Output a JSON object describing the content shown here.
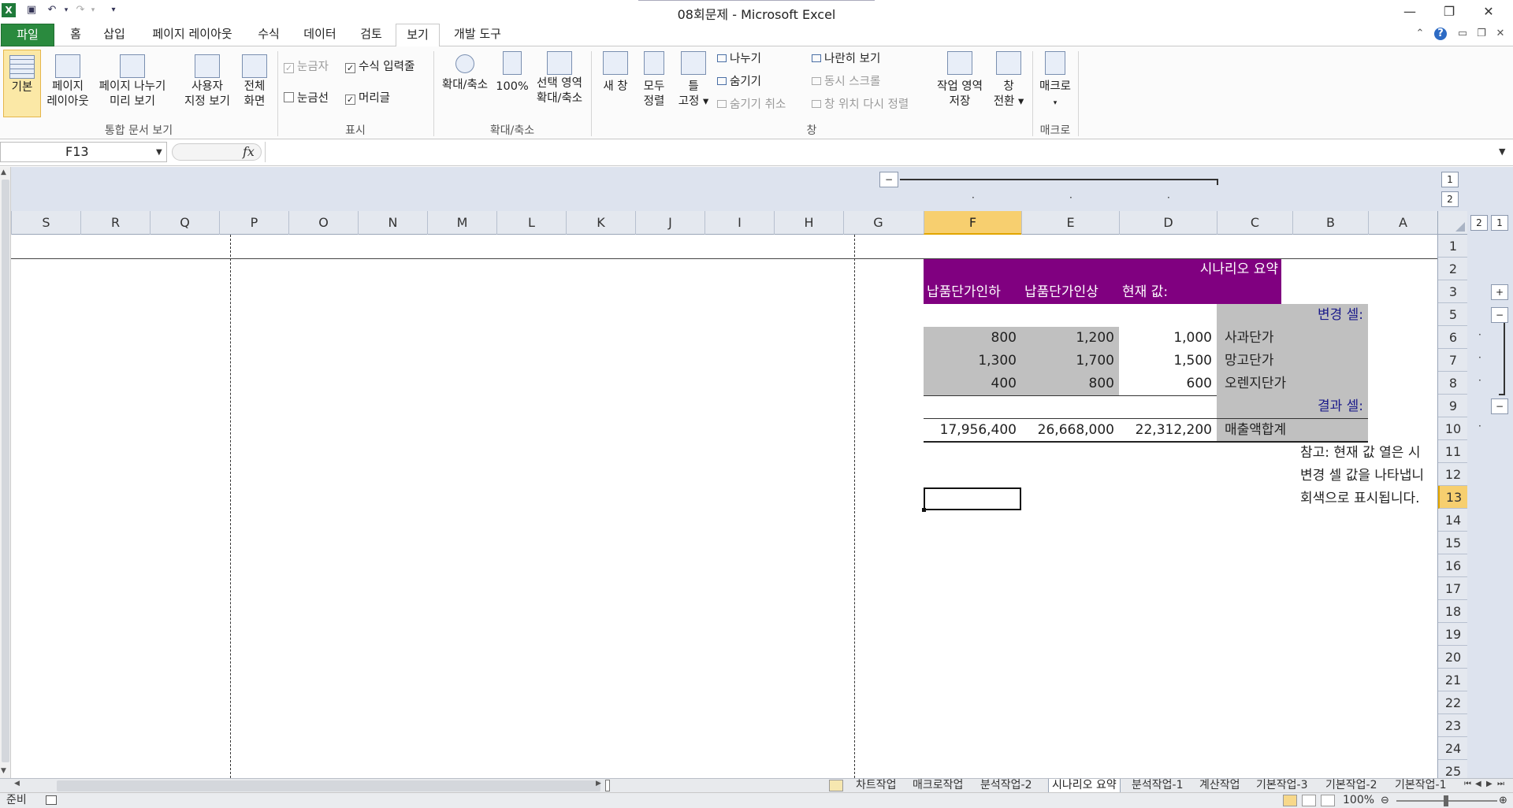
{
  "window": {
    "title": "08회문제 - Microsoft Excel"
  },
  "qat": {
    "excel_icon": "X"
  },
  "tabs": [
    {
      "label": "파일"
    },
    {
      "label": "홈"
    },
    {
      "label": "삽입"
    },
    {
      "label": "페이지 레이아웃"
    },
    {
      "label": "수식"
    },
    {
      "label": "데이터"
    },
    {
      "label": "검토"
    },
    {
      "label": "보기"
    },
    {
      "label": "개발 도구"
    }
  ],
  "ribbon": {
    "views": {
      "normal": "기본",
      "page_layout_1": "페이지",
      "page_layout_2": "레이아웃",
      "page_break_1": "페이지 나누기",
      "page_break_2": "미리 보기",
      "custom_1": "사용자",
      "custom_2": "지정 보기",
      "full_1": "전체",
      "full_2": "화면",
      "group": "통합 문서 보기"
    },
    "show": {
      "ruler": "눈금자",
      "formula_bar": "수식 입력줄",
      "gridlines": "눈금선",
      "headings": "머리글",
      "group": "표시"
    },
    "zoom": {
      "zoom": "확대/축소",
      "hundred": "100%",
      "sel_1": "선택 영역",
      "sel_2": "확대/축소",
      "group": "확대/축소"
    },
    "window": {
      "new": "새 창",
      "arrange_1": "모두",
      "arrange_2": "정렬",
      "freeze_1": "틀",
      "freeze_2": "고정 ▾",
      "split": "나누기",
      "hide": "숨기기",
      "unhide": "숨기기 취소",
      "side": "나란히 보기",
      "sync": "동시 스크롤",
      "reset": "창 위치 다시 정렬",
      "save_1": "작업 영역",
      "save_2": "저장",
      "switch_1": "창",
      "switch_2": "전환 ▾",
      "group": "창"
    },
    "macro": {
      "label": "매크로",
      "group": "매크로"
    }
  },
  "formula": {
    "namebox": "F13",
    "fx": "fx",
    "value": ""
  },
  "outline": {
    "col_levels": [
      "1",
      "2"
    ],
    "row_levels": [
      "2",
      "1"
    ]
  },
  "columns": [
    "S",
    "R",
    "Q",
    "P",
    "O",
    "N",
    "M",
    "L",
    "K",
    "J",
    "I",
    "H",
    "G",
    "F",
    "E",
    "D",
    "C",
    "B",
    "A"
  ],
  "rows": [
    "1",
    "2",
    "3",
    "5",
    "6",
    "7",
    "8",
    "9",
    "10",
    "11",
    "12",
    "13",
    "14",
    "15",
    "16",
    "17",
    "18",
    "19",
    "20",
    "21",
    "22",
    "23",
    "24",
    "25"
  ],
  "scenario": {
    "title": "시나리오 요약",
    "headers": {
      "f": "납품단가인하",
      "e": "납품단가인상",
      "d": "현재 값:"
    },
    "changing_label": "변경 셀:",
    "changing_rows": [
      {
        "name": "사과단가",
        "f": "800",
        "e": "1,200",
        "d": "1,000"
      },
      {
        "name": "망고단가",
        "f": "1,300",
        "e": "1,700",
        "d": "1,500"
      },
      {
        "name": "오렌지단가",
        "f": "400",
        "e": "800",
        "d": "600"
      }
    ],
    "result_label": "결과 셀:",
    "result_row": {
      "name": "매출액합계",
      "f": "17,956,400",
      "e": "26,668,000",
      "d": "22,312,200"
    },
    "note": [
      "참고: 현재 값 열은 시",
      "변경 셀 값을 나타냅니",
      "회색으로 표시됩니다."
    ]
  },
  "sheets": [
    "차트작업",
    "매크로작업",
    "분석작업-2",
    "시나리오 요약",
    "분석작업-1",
    "계산작업",
    "기본작업-3",
    "기본작업-2",
    "기본작업-1"
  ],
  "status": {
    "ready": "준비",
    "zoom": "100%"
  }
}
